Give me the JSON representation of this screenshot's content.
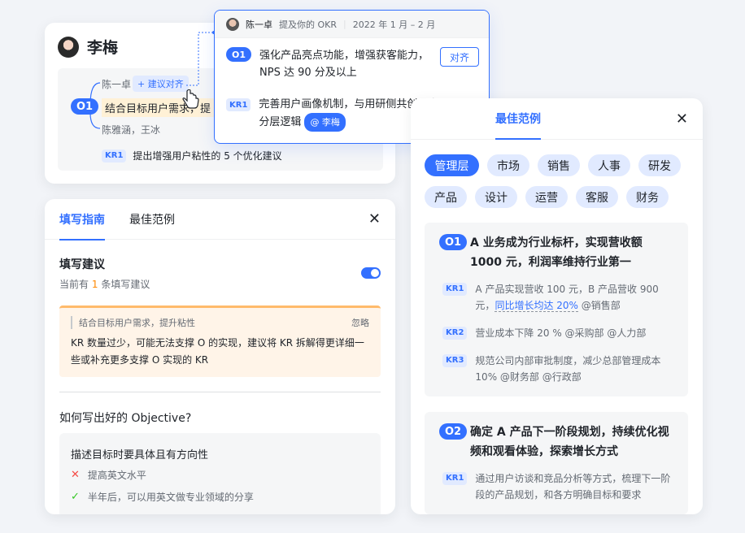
{
  "okr_card": {
    "user_name": "李梅",
    "objective_badge": "O1",
    "objective_text": "结合目标用户需求，提",
    "top_assignee": "陈一卓",
    "suggest_chip": "+ 建议对齐",
    "bottom_assignees": "陈雅涵，王冰",
    "kr_badge": "KR1",
    "kr_text": "提出增强用户粘性的 5 个优化建议"
  },
  "popover": {
    "author": "陈一卓",
    "meta": "提及你的 OKR",
    "period": "2022 年 1 月 – 2 月",
    "o_badge": "O1",
    "o_text": "强化产品亮点功能，增强获客能力，NPS 达 90 分及以上",
    "align_button": "对齐",
    "kr_badge": "KR1",
    "kr_text": "完善用户画像机制，与用研侧共创用户分层逻辑",
    "mention": "@ 李梅"
  },
  "guide": {
    "tabs": [
      "填写指南",
      "最佳范例"
    ],
    "section_title": "填写建议",
    "count_prefix": "当前有",
    "count_value": "1",
    "count_suffix": "条填写建议",
    "warning_ref": "结合目标用户需求，提升粘性",
    "ignore": "忽略",
    "warning_text": "KR 数量过少，可能无法支撑 O 的实现，建议将 KR 拆解得更详细一些或补充更多支撑 O 实现的 KR",
    "question": "如何写出好的 Objective?",
    "tip_title": "描述目标时要具体且有方向性",
    "bad_example": "提高英文水平",
    "good_example": "半年后，可以用英文做专业领域的分享"
  },
  "examples": {
    "tab_label": "最佳范例",
    "categories": [
      "管理层",
      "市场",
      "销售",
      "人事",
      "研发",
      "产品",
      "设计",
      "运营",
      "客服",
      "财务"
    ],
    "active_category": "管理层",
    "o1": {
      "badge": "O1",
      "text": "A 业务成为行业标杆，实现营收额 1000 元，利润率维持行业第一",
      "krs": [
        {
          "badge": "KR1",
          "text_a": "A 产品实现营收 100 元，B 产品营收 900 元，",
          "text_link": "同比增长均达 20%",
          "text_b": " @销售部"
        },
        {
          "badge": "KR2",
          "text": "营业成本下降 20 % @采购部 @人力部"
        },
        {
          "badge": "KR3",
          "text": "规范公司内部审批制度，减少总部管理成本 10% @财务部 @行政部"
        }
      ]
    },
    "o2": {
      "badge": "O2",
      "text": "确定 A 产品下一阶段规划，持续优化视频和观看体验，探索增长方式",
      "kr_badge": "KR1",
      "kr_text": "通过用户访谈和竞品分析等方式，梳理下一阶段的产品规划，和各方明确目标和要求"
    }
  },
  "icons": {
    "close": "close-icon",
    "cross": "cross-icon",
    "check": "check-icon",
    "cursor": "hand-cursor-icon"
  },
  "colors": {
    "primary": "#3370ff",
    "warning_bg": "#fff4e8",
    "warning_border": "#ffba6b",
    "chip_bg": "#e1eaff"
  }
}
